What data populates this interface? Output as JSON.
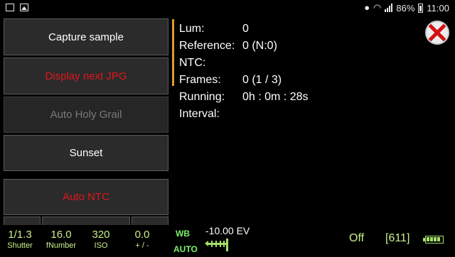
{
  "status_bar": {
    "left_icons": [
      "screenshot-icon",
      "gallery-icon"
    ],
    "right_icons": [
      "location-icon",
      "wifi-icon",
      "signal-icon",
      "battery-icon"
    ],
    "battery_percent": "86%",
    "time": "11:00"
  },
  "buttons": [
    {
      "label": "Capture sample",
      "state": "enabled",
      "color": "#ffffff"
    },
    {
      "label": "Display next JPG",
      "state": "enabled",
      "color": "#e0161b"
    },
    {
      "label": "Auto Holy Grail",
      "state": "disabled",
      "color": "#7a7a7a"
    },
    {
      "label": "Sunset",
      "state": "enabled",
      "color": "#ffffff"
    },
    {
      "label": "Auto NTC",
      "state": "enabled",
      "color": "#e0161b"
    }
  ],
  "info": {
    "lum_label": "Lum:",
    "lum_value": "0",
    "reference_label": "Reference:",
    "reference_value": "0 (N:0)",
    "ntc_label": "NTC:",
    "ntc_value": "",
    "frames_label": "Frames:",
    "frames_value": "0 (1 / 3)",
    "running_label": "Running:",
    "running_value": "0h : 0m : 28s",
    "interval_label": "Interval:",
    "interval_value": ""
  },
  "camera": {
    "shutter": {
      "value": "1/1.3",
      "label": "Shutter"
    },
    "fnumber": {
      "value": "16.0",
      "label": "fNumber"
    },
    "iso": {
      "value": "320",
      "label": "ISO"
    },
    "ev_comp": {
      "value": "0.0",
      "label": "+ / -"
    },
    "wb_label": "WB",
    "wb_value": "AUTO",
    "ev_scale_text": "-10.00 EV",
    "mode": "Off",
    "shots": "[611]",
    "battery_level": 1.0
  },
  "colors": {
    "accent_orange": "#e39a2d",
    "param_green": "#c9f08a",
    "wb_green": "#7cf06a",
    "button_red": "#e0161b",
    "close_red": "#d41010"
  }
}
